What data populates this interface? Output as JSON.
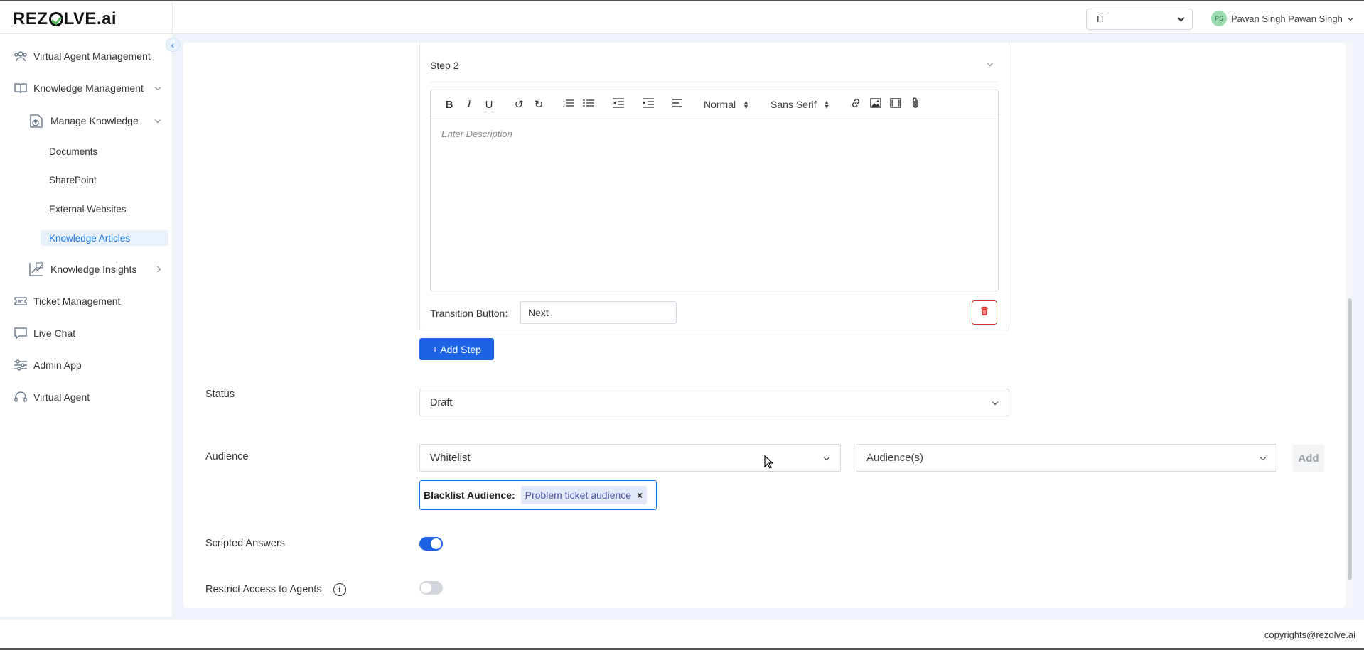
{
  "app": {
    "brand_prefix": "REZ",
    "brand_suffix": "LVE.ai",
    "domain_value": "IT",
    "user_name": "Pawan Singh Pawan Singh",
    "user_initials": "PS",
    "copyright": "copyrights@rezolve.ai"
  },
  "sidebar": {
    "items": [
      {
        "label": "Virtual Agent Management",
        "icon": "users-group-icon"
      },
      {
        "label": "Knowledge Management",
        "icon": "book-icon"
      },
      {
        "label": "Manage Knowledge",
        "icon": "knowledge-upload-icon"
      },
      {
        "label": "Documents"
      },
      {
        "label": "SharePoint"
      },
      {
        "label": "External Websites"
      },
      {
        "label": "Knowledge Articles"
      },
      {
        "label": "Knowledge Insights",
        "icon": "chart-icon"
      },
      {
        "label": "Ticket Management",
        "icon": "ticket-icon"
      },
      {
        "label": "Live Chat",
        "icon": "chat-icon"
      },
      {
        "label": "Admin App",
        "icon": "sliders-icon"
      },
      {
        "label": "Virtual Agent",
        "icon": "headset-icon"
      }
    ]
  },
  "step": {
    "title": "Step 2",
    "toolbar": {
      "format_select": "Normal",
      "font_select": "Sans Serif"
    },
    "editor_placeholder": "Enter Description",
    "transition_label": "Transition Button:",
    "transition_value": "Next"
  },
  "add_step_label": "+ Add Step",
  "status": {
    "label": "Status",
    "value": "Draft"
  },
  "audience": {
    "label": "Audience",
    "type_value": "Whitelist",
    "audience_placeholder": "Audience(s)",
    "add_label": "Add",
    "blacklist_label": "Blacklist Audience:",
    "blacklist_tags": [
      "Problem ticket audience"
    ],
    "tag_remove": "×"
  },
  "scripted_answers": {
    "label": "Scripted Answers",
    "enabled": true
  },
  "restrict_access": {
    "label": "Restrict Access to Agents",
    "enabled": false,
    "info_icon": "info-icon"
  }
}
